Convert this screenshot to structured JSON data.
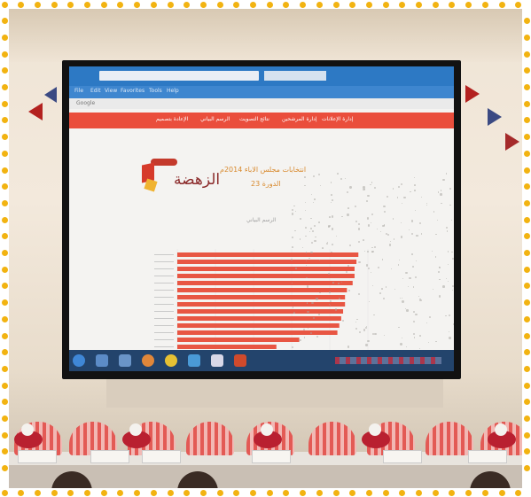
{
  "screen": {
    "browser": {
      "menu_items": [
        "File",
        "Edit",
        "View",
        "Favorites",
        "Tools",
        "Help"
      ],
      "search_label": "Google"
    },
    "nav_items": [
      "إدارة الإعلانات",
      "إدارة المرشحين",
      "نتائج التصويت",
      "الرسم البياني",
      "الإعادة بتصميم"
    ],
    "logo_text": "الزهضة",
    "title_line": "انتخابات مجلس الاباء 2014م",
    "subtitle_line": "الدورة 23",
    "chart_caption": "الرسم البياني"
  },
  "chart_data": {
    "type": "bar",
    "orientation": "horizontal",
    "title": "",
    "categories": [
      "",
      "",
      "",
      "",
      "",
      "",
      "",
      "",
      "",
      "",
      "",
      "",
      "",
      ""
    ],
    "values": [
      95,
      94,
      93,
      93,
      92,
      89,
      88,
      88,
      87,
      86,
      85,
      84,
      64,
      52
    ],
    "xlim": [
      0,
      100
    ],
    "bar_color": "#e85643"
  }
}
